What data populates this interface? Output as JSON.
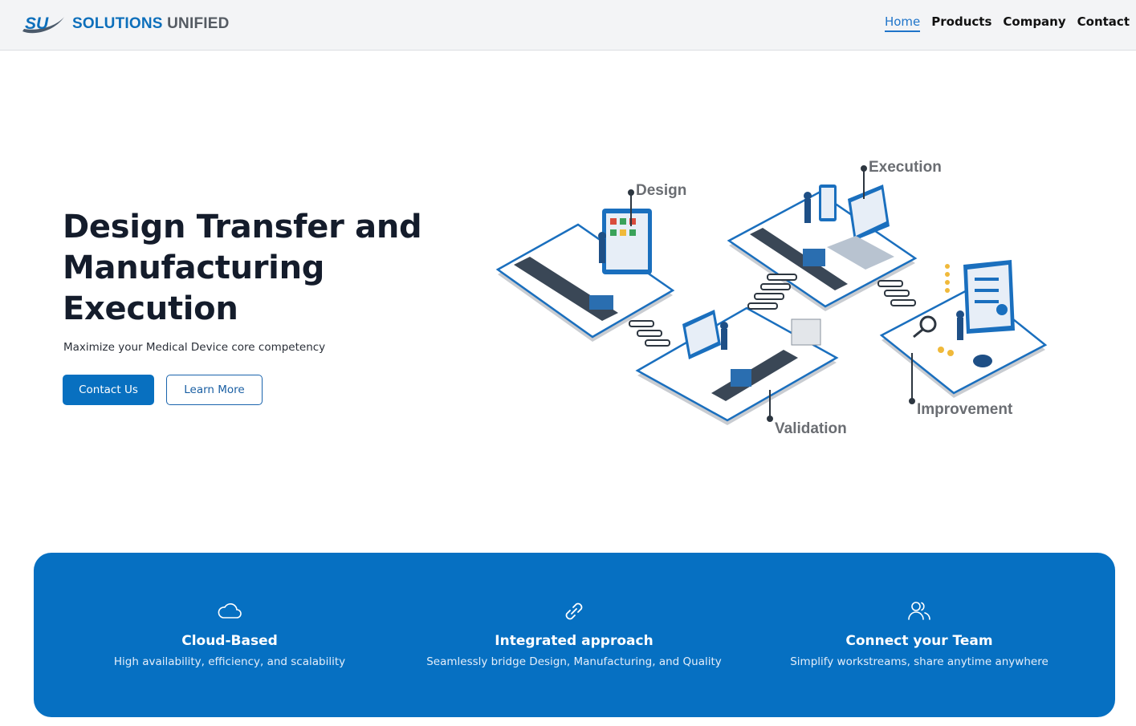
{
  "brand": {
    "name_part1": "SOLUTIONS",
    "name_part2": "UNIFIED",
    "logo_mark_text": "SU",
    "primary_color": "#0670c2"
  },
  "nav": {
    "items": [
      {
        "label": "Home",
        "active": true
      },
      {
        "label": "Products"
      },
      {
        "label": "Company"
      },
      {
        "label": "Contact"
      }
    ]
  },
  "hero": {
    "title": "Design Transfer and Manufacturing Execution",
    "subtitle": "Maximize your Medical Device core competency",
    "primary_button": "Contact Us",
    "secondary_button": "Learn More"
  },
  "illustration": {
    "labels": {
      "design": "Design",
      "execution": "Execution",
      "validation": "Validation",
      "improvement": "Improvement"
    }
  },
  "features": [
    {
      "icon": "cloud-icon",
      "title": "Cloud-Based",
      "description": "High availability, efficiency, and scalability"
    },
    {
      "icon": "link-icon",
      "title": "Integrated approach",
      "description": "Seamlessly bridge Design, Manufacturing, and Quality"
    },
    {
      "icon": "users-icon",
      "title": "Connect your Team",
      "description": "Simplify workstreams, share anytime anywhere"
    }
  ]
}
